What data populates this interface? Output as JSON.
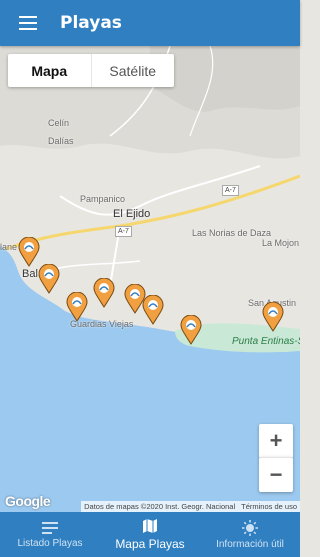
{
  "app": {
    "title": "Playas"
  },
  "map_type": {
    "options": [
      "Mapa",
      "Satélite"
    ],
    "selected": "Mapa"
  },
  "map_labels": {
    "celin": "Celín",
    "dalias": "Dalías",
    "pampanico": "Pampanico",
    "el_ejido": "El Ejido",
    "las_norias": "Las Norias de Daza",
    "la_mojonera": "La Mojon",
    "balerma": "Bal",
    "balanegra": "lane",
    "guardias_viejas": "Guardias Viejas",
    "san_agustin": "San Agustin",
    "punta_entinas": "Punta Entinas-Sabi",
    "road_a7": "A-7"
  },
  "zoom": {
    "in": "+",
    "out": "−"
  },
  "attribution": {
    "data": "Datos de mapas ©2020 Inst. Geogr. Nacional",
    "terms": "Términos de uso",
    "logo": "Google"
  },
  "bottom_nav": [
    {
      "label": "Listado Playas",
      "icon": "list-icon",
      "active": false
    },
    {
      "label": "Mapa Playas",
      "icon": "map-icon",
      "active": true
    },
    {
      "label": "Información útil",
      "icon": "sun-icon",
      "active": false
    }
  ],
  "colors": {
    "primary": "#2f7fc1",
    "sea": "#9cc9ef",
    "land": "#e8e6e1",
    "pin": "#f0a040"
  }
}
